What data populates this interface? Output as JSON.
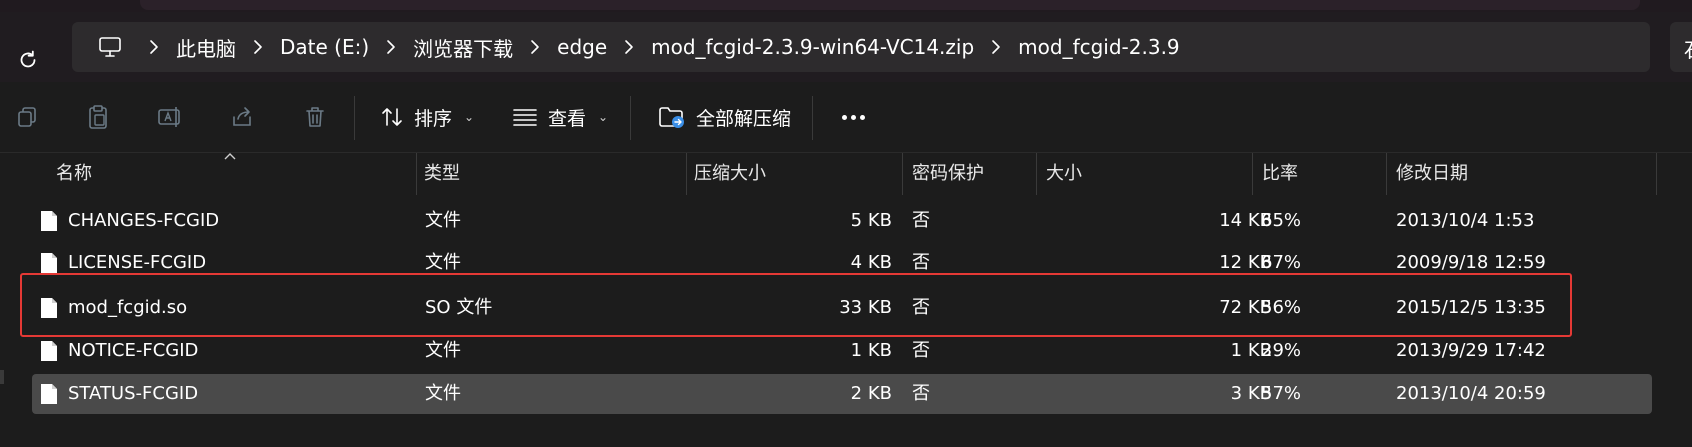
{
  "toolbar_top": {
    "refresh_icon": "refresh-icon"
  },
  "address": {
    "pc_icon": "computer-icon",
    "crumbs": [
      "此电脑",
      "Date (E:)",
      "浏览器下载",
      "edge",
      "mod_fcgid-2.3.9-win64-VC14.zip",
      "mod_fcgid-2.3.9"
    ],
    "right_stub": "石"
  },
  "commands": {
    "copy_icon": "copy-icon",
    "paste_icon": "paste-icon",
    "rename_icon": "rename-icon",
    "share_icon": "share-icon",
    "delete_icon": "trash-icon",
    "sort_label": "排序",
    "view_label": "查看",
    "extract_label": "全部解压缩"
  },
  "columns": {
    "name": "名称",
    "type": "类型",
    "compressed": "压缩大小",
    "password": "密码保护",
    "size": "大小",
    "ratio": "比率",
    "modified": "修改日期"
  },
  "files": [
    {
      "name": "CHANGES-FCGID",
      "type": "文件",
      "compressed": "5 KB",
      "password": "否",
      "size": "14 KB",
      "ratio": "65%",
      "modified": "2013/10/4 1:53"
    },
    {
      "name": "LICENSE-FCGID",
      "type": "文件",
      "compressed": "4 KB",
      "password": "否",
      "size": "12 KB",
      "ratio": "67%",
      "modified": "2009/9/18 12:59"
    },
    {
      "name": "mod_fcgid.so",
      "type": "SO 文件",
      "compressed": "33 KB",
      "password": "否",
      "size": "72 KB",
      "ratio": "56%",
      "modified": "2015/12/5 13:35"
    },
    {
      "name": "NOTICE-FCGID",
      "type": "文件",
      "compressed": "1 KB",
      "password": "否",
      "size": "1 KB",
      "ratio": "29%",
      "modified": "2013/9/29 17:42"
    },
    {
      "name": "STATUS-FCGID",
      "type": "文件",
      "compressed": "2 KB",
      "password": "否",
      "size": "3 KB",
      "ratio": "57%",
      "modified": "2013/10/4 20:59"
    }
  ],
  "colors": {
    "background": "#1c1c1c",
    "selected_row": "#4a4a4a",
    "highlight_border": "#e53935"
  }
}
